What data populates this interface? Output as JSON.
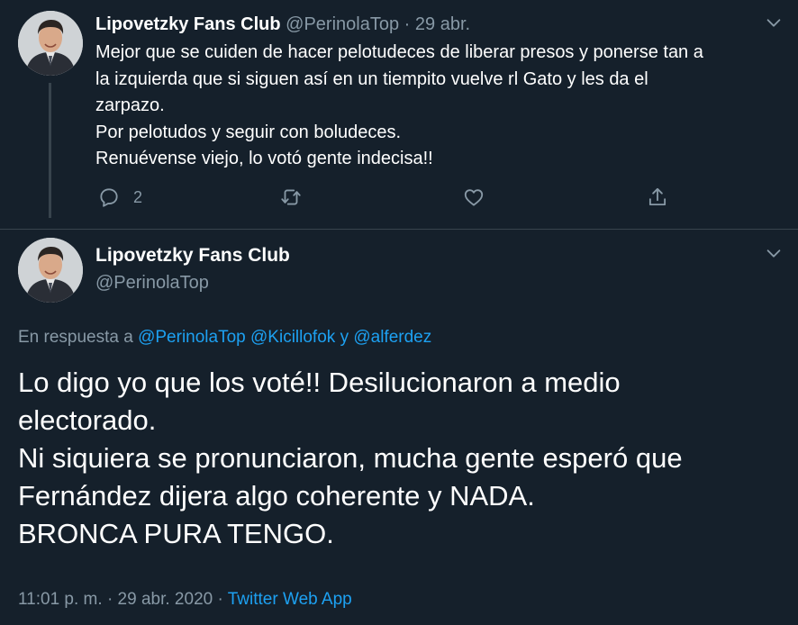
{
  "tweet1": {
    "display_name": "Lipovetzky Fans Club",
    "handle": "@PerinolaTop",
    "separator": "·",
    "date": "29 abr.",
    "lines": [
      "Mejor que se cuiden de hacer pelotudeces de liberar presos y ponerse tan a",
      "la izquierda que si siguen así en un tiempito vuelve rl Gato y les da el",
      "zarpazo.",
      "Por pelotudos y seguir con boludeces.",
      "Renuévense viejo, lo votó gente indecisa!!"
    ],
    "reply_count": "2",
    "icons": {
      "reply": "reply-icon",
      "retweet": "retweet-icon",
      "like": "like-icon",
      "share": "share-icon",
      "menu": "chevron-down-icon"
    }
  },
  "tweet2": {
    "display_name": "Lipovetzky Fans Club",
    "handle": "@PerinolaTop",
    "reply_prefix": "En respuesta a",
    "reply_mention_1": "@PerinolaTop",
    "reply_mention_2": "@Kicillofok",
    "reply_conjunction": "y",
    "reply_mention_3": "@alferdez",
    "lines": [
      "Lo digo yo que los voté!! Desilucionaron a medio",
      "electorado.",
      "Ni siquiera se pronunciaron, mucha gente esperó que",
      "Fernández dijera algo coherente y NADA.",
      "BRONCA PURA TENGO."
    ],
    "time": "11:01 p. m.",
    "meta_separator": "·",
    "date": "29 abr. 2020",
    "meta_separator_2": "·",
    "source": "Twitter Web App"
  },
  "colors": {
    "background": "#15202b",
    "text": "#ffffff",
    "muted": "#8899a6",
    "link": "#1da1f2",
    "divider": "#38444d"
  }
}
